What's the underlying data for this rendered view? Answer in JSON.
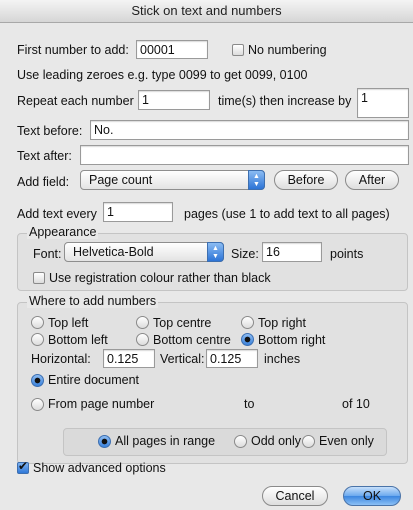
{
  "window": {
    "title": "Stick on text and numbers"
  },
  "numbering": {
    "first_number_label": "First number to add:",
    "first_number_value": "00001",
    "no_numbering_label": "No numbering",
    "no_numbering_checked": false,
    "leading_zeroes_hint": "Use leading zeroes e.g. type 0099 to get 0099, 0100",
    "repeat_label": "Repeat each number",
    "repeat_value": "1",
    "times_label": "time(s) then increase by",
    "increase_value": "1"
  },
  "text": {
    "before_label": "Text before:",
    "before_value": "No.",
    "after_label": "Text after:",
    "after_value": ""
  },
  "add_field": {
    "label": "Add field:",
    "selected": "Page count",
    "before_button": "Before",
    "after_button": "After"
  },
  "add_text_every": {
    "label": "Add text every",
    "value": "1",
    "suffix": "pages (use 1 to add text to all pages)"
  },
  "appearance": {
    "legend": "Appearance",
    "font_label": "Font:",
    "font_selected": "Helvetica-Bold",
    "size_label": "Size:",
    "size_value": "16",
    "points_label": "points",
    "registration_label": "Use registration colour rather than black",
    "registration_checked": false
  },
  "position": {
    "legend": "Where to add numbers",
    "top_left": "Top left",
    "top_centre": "Top centre",
    "top_right": "Top right",
    "bottom_left": "Bottom left",
    "bottom_centre": "Bottom centre",
    "bottom_right": "Bottom right",
    "selected": "Bottom right",
    "horizontal_label": "Horizontal:",
    "horizontal_value": "0.125",
    "vertical_label": "Vertical:",
    "vertical_value": "0.125",
    "inches_label": "inches"
  },
  "range": {
    "entire_document": "Entire document",
    "from_page": "From page number",
    "to_label": "to",
    "of_label": "of 10",
    "selected": "Entire document",
    "all_pages": "All pages in range",
    "odd_only": "Odd only",
    "even_only": "Even only",
    "pages_selected": "All pages in range"
  },
  "advanced": {
    "label": "Show advanced options",
    "checked": true
  },
  "buttons": {
    "cancel": "Cancel",
    "ok": "OK"
  }
}
